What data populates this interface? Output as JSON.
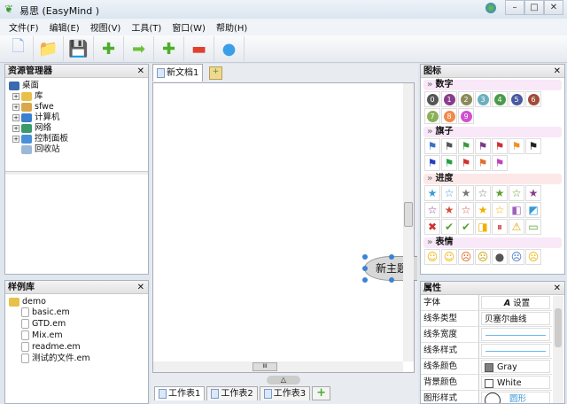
{
  "window": {
    "title": "易思 (EasyMind )",
    "minimize": "–",
    "maximize": "□",
    "close": "✕"
  },
  "menu": [
    "文件(F)",
    "编辑(E)",
    "视图(V)",
    "工具(T)",
    "窗口(W)",
    "帮助(H)"
  ],
  "toolbar": [
    {
      "icon": "new-file-icon",
      "glyph": "🗋",
      "color": "#8fb4e6"
    },
    {
      "icon": "open-folder-icon",
      "glyph": "📁",
      "color": "#e8c04a"
    },
    {
      "icon": "save-icon",
      "glyph": "💾",
      "color": "#c0c0c0"
    },
    {
      "icon": "add-topic-icon",
      "glyph": "✚",
      "color": "#4cae28"
    },
    {
      "icon": "add-sibling-icon",
      "glyph": "➡",
      "color": "#6cc13c"
    },
    {
      "icon": "add-child-icon",
      "glyph": "✚",
      "color": "#4cae28"
    },
    {
      "icon": "delete-topic-icon",
      "glyph": "▬",
      "color": "#e04030"
    },
    {
      "icon": "users-icon",
      "glyph": "●",
      "color": "#3a9ee8"
    }
  ],
  "explorer": {
    "title": "资源管理器",
    "close": "✕",
    "root": "桌面",
    "items": [
      {
        "label": "库",
        "expand": "+",
        "color": "#e8c04a"
      },
      {
        "label": "sfwe",
        "expand": "+",
        "color": "#d9a84a"
      },
      {
        "label": "计算机",
        "expand": "+",
        "color": "#3a7fd0"
      },
      {
        "label": "网络",
        "expand": "+",
        "color": "#3a9a6a"
      },
      {
        "label": "控制面板",
        "expand": "+",
        "color": "#4a90d9"
      },
      {
        "label": "回收站",
        "expand": "",
        "color": "#9ab8d8"
      }
    ]
  },
  "samples": {
    "title": "样例库",
    "close": "✕",
    "folder": "demo",
    "files": [
      "basic.em",
      "GTD.em",
      "Mix.em",
      "readme.em",
      "测试的文件.em"
    ]
  },
  "editor": {
    "tab": "新文档1",
    "topic": "新主题",
    "sheets": [
      "工作表1",
      "工作表2",
      "工作表3"
    ],
    "hscroll": "III",
    "add_sheet": "+"
  },
  "icons": {
    "title": "图标",
    "close": "✕",
    "sections": [
      {
        "name": "数字",
        "items": [
          {
            "t": "0",
            "c": "#555"
          },
          {
            "t": "1",
            "c": "#8a3c8a"
          },
          {
            "t": "2",
            "c": "#8a8a5a"
          },
          {
            "t": "3",
            "c": "#6ab0c0"
          },
          {
            "t": "4",
            "c": "#4a9a4a"
          },
          {
            "t": "5",
            "c": "#4a5aa0"
          },
          {
            "t": "6",
            "c": "#a04a3a"
          },
          {
            "t": "7",
            "c": "#8ab05a"
          },
          {
            "t": "8",
            "c": "#f08a4a"
          },
          {
            "t": "9",
            "c": "#d050d0"
          }
        ]
      },
      {
        "name": "旗子",
        "items": [
          {
            "t": "⚑",
            "c": "#3a70c8"
          },
          {
            "t": "⚑",
            "c": "#555"
          },
          {
            "t": "⚑",
            "c": "#3a9a3a"
          },
          {
            "t": "⚑",
            "c": "#7a3a8a"
          },
          {
            "t": "⚑",
            "c": "#d03030"
          },
          {
            "t": "⚑",
            "c": "#f09020"
          },
          {
            "t": "⚑",
            "c": "#222"
          },
          {
            "t": "⚑",
            "c": "#2040c0"
          },
          {
            "t": "⚑",
            "c": "#20a040"
          },
          {
            "t": "⚑",
            "c": "#d03030"
          },
          {
            "t": "⚑",
            "c": "#e07030"
          },
          {
            "t": "⚑",
            "c": "#c040c0"
          }
        ]
      },
      {
        "name": "进度",
        "items": [
          {
            "t": "★",
            "c": "#3a9ad8"
          },
          {
            "t": "☆",
            "c": "#3a9ad8"
          },
          {
            "t": "★",
            "c": "#777"
          },
          {
            "t": "☆",
            "c": "#777"
          },
          {
            "t": "★",
            "c": "#5aa030"
          },
          {
            "t": "☆",
            "c": "#5aa030"
          },
          {
            "t": "★",
            "c": "#8a3c8a"
          },
          {
            "t": "☆",
            "c": "#8a3c8a"
          },
          {
            "t": "★",
            "c": "#d05040"
          },
          {
            "t": "☆",
            "c": "#d05040"
          },
          {
            "t": "★",
            "c": "#f0b000"
          },
          {
            "t": "☆",
            "c": "#f0b000"
          },
          {
            "t": "◧",
            "c": "#a060c0"
          },
          {
            "t": "◩",
            "c": "#3a9ad8"
          },
          {
            "t": "✖",
            "c": "#d03030"
          },
          {
            "t": "✔",
            "c": "#5aa030"
          },
          {
            "t": "✔",
            "c": "#5aa030"
          },
          {
            "t": "◨",
            "c": "#f0b000"
          },
          {
            "t": "⏸",
            "c": "#d03030"
          },
          {
            "t": "⚠",
            "c": "#e0a000"
          },
          {
            "t": "▭",
            "c": "#5aa030"
          }
        ]
      },
      {
        "name": "表情",
        "items": [
          {
            "t": "☺",
            "c": "#f0b000"
          },
          {
            "t": "☺",
            "c": "#f0b000"
          },
          {
            "t": "☹",
            "c": "#e06020"
          },
          {
            "t": "☹",
            "c": "#c0a000"
          },
          {
            "t": "●",
            "c": "#555"
          },
          {
            "t": "☹",
            "c": "#3a70c8"
          },
          {
            "t": "☹",
            "c": "#f0b000"
          }
        ]
      }
    ]
  },
  "properties": {
    "title": "属性",
    "close": "✕",
    "rows": [
      {
        "key": "字体",
        "value": "设置"
      },
      {
        "key": "线条类型",
        "value": "贝塞尔曲线"
      },
      {
        "key": "线条宽度",
        "value": ""
      },
      {
        "key": "线条样式",
        "value": ""
      },
      {
        "key": "线条颜色",
        "value": "Gray",
        "swatch": "#808080"
      },
      {
        "key": "背景颜色",
        "value": "White",
        "swatch": "#ffffff"
      },
      {
        "key": "图形样式",
        "value": "圆形"
      }
    ]
  }
}
